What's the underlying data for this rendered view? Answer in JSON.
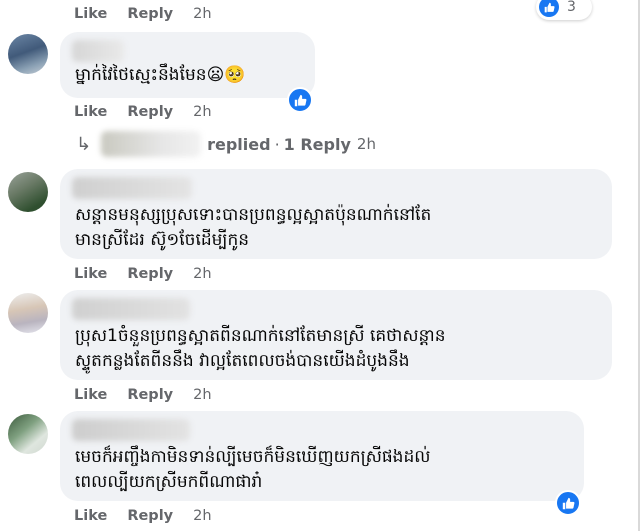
{
  "actions": {
    "like": "Like",
    "reply": "Reply"
  },
  "top_actions": {
    "time": "2h",
    "reaction_count": "3"
  },
  "comments": [
    {
      "text": "ម្នាក់វៃថៃស្មេះនឹងមែន😦🥺",
      "time": "2h"
    },
    {
      "text": "សន្ដានមនុស្សប្រុសទោះបានប្រពន្ធល្អស្អាតប៉ុនណាក់នៅតែ\nមានស្រីដែរ ស៊ូ១ចែដើម្បីកូន",
      "time": "2h"
    },
    {
      "text": "ប្រុស1ចំនួនប្រពន្ធស្អាតពីនណាក់នៅតែមានស្រី គេថាសន្ដាន\nស្ទូតកន្លងតែពីននឹង វាល្អតែពេលចង់បានយើងដំបូងនឹង",
      "time": "2h"
    },
    {
      "text": "មេចក៏អញ្ចឹងកាមិនទាន់ល្បីមេចក៏មិនឃើញយកស្រីផងដល់\nពេលល្បីយកស្រីមកពីណាផារា៎",
      "time": "2h"
    }
  ],
  "reply_summary": {
    "replied": "replied",
    "separator": "·",
    "count": "1 Reply",
    "time": "2h"
  },
  "colors": {
    "bubble": "#f0f2f5",
    "meta": "#65676b",
    "like_blue": "#1877f2"
  }
}
